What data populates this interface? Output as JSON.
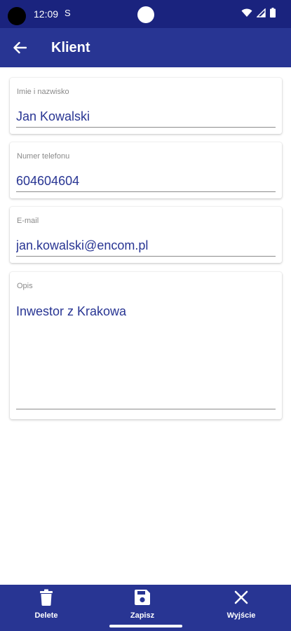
{
  "status_bar": {
    "time": "12:09",
    "app_icon_glyph": "S"
  },
  "app_bar": {
    "title": "Klient",
    "back_icon": "arrow-back-icon"
  },
  "fields": {
    "name": {
      "label": "Imie i nazwisko",
      "value": "Jan Kowalski"
    },
    "phone": {
      "label": "Numer telefonu",
      "value": "604604604"
    },
    "email": {
      "label": "E-mail",
      "value": "jan.kowalski@encom.pl"
    },
    "description": {
      "label": "Opis",
      "value": "Inwestor z Krakowa"
    }
  },
  "bottom_nav": {
    "delete": {
      "label": "Delete",
      "icon": "trash-icon"
    },
    "save": {
      "label": "Zapisz",
      "icon": "floppy-disk-icon"
    },
    "exit": {
      "label": "Wyjście",
      "icon": "close-icon"
    }
  },
  "colors": {
    "status_bar": "#1a237e",
    "primary": "#283593",
    "text_value": "#283593",
    "label": "#8a8a8a"
  }
}
